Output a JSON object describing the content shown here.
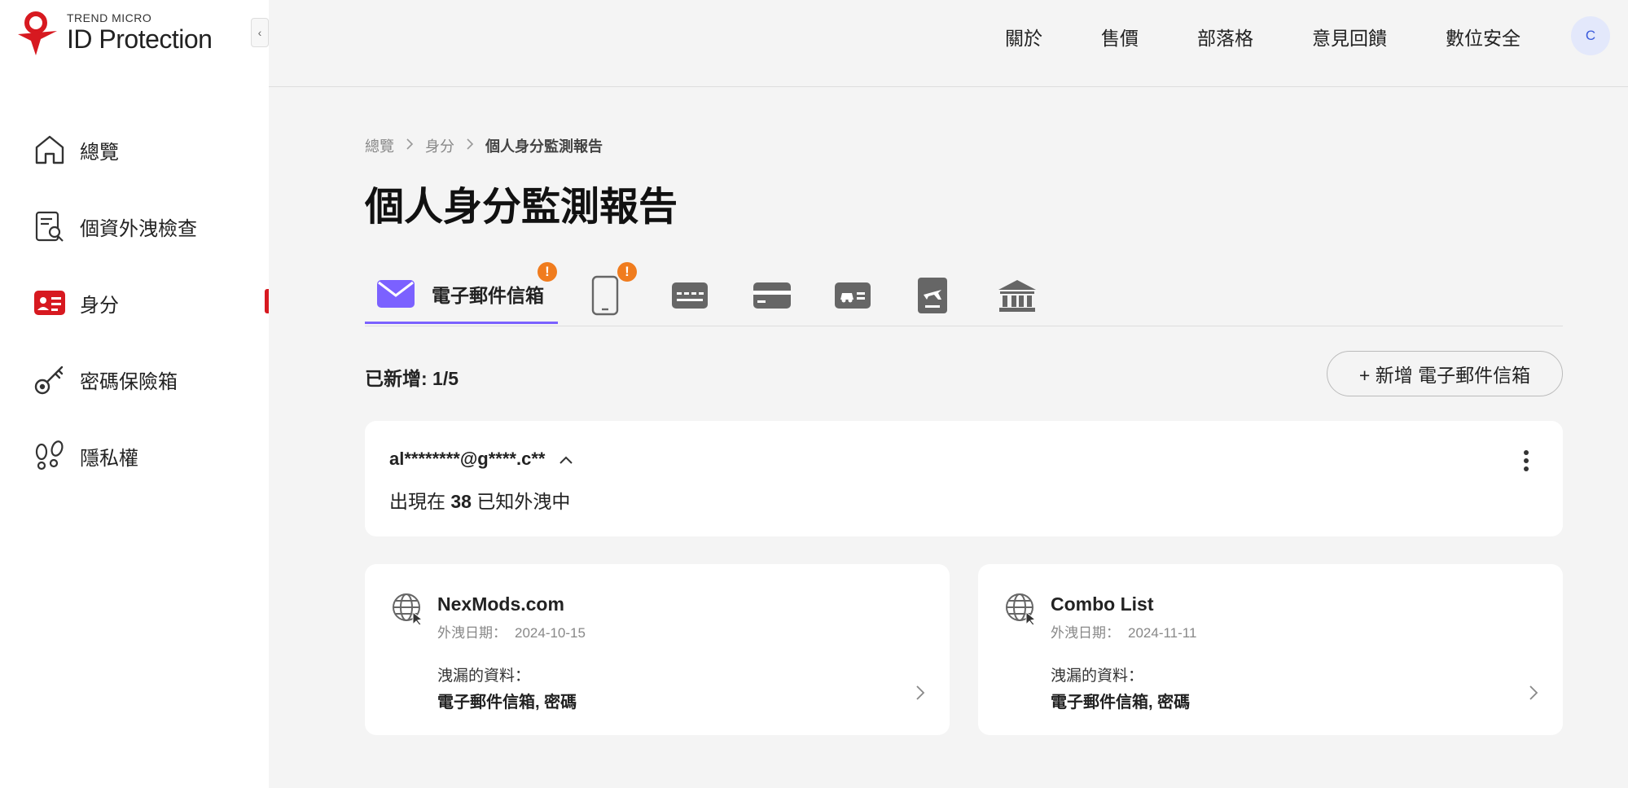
{
  "brand": {
    "top": "TREND MICRO",
    "main": "ID Protection",
    "color": "#d71920"
  },
  "sidebar": {
    "collapse_label": "‹",
    "items": [
      {
        "label": "總覽",
        "icon": "home-icon"
      },
      {
        "label": "個資外洩檢查",
        "icon": "document-search-icon"
      },
      {
        "label": "身分",
        "icon": "id-card-icon",
        "active": true
      },
      {
        "label": "密碼保險箱",
        "icon": "key-icon"
      },
      {
        "label": "隱私權",
        "icon": "footprints-icon"
      }
    ]
  },
  "topnav": {
    "links": [
      "關於",
      "售價",
      "部落格",
      "意見回饋",
      "數位安全"
    ],
    "avatar_initial": "C"
  },
  "breadcrumb": {
    "items": [
      "總覽",
      "身分",
      "個人身分監測報告"
    ],
    "separator": ">"
  },
  "page_title": "個人身分監測報告",
  "tabs": [
    {
      "label": "電子郵件信箱",
      "icon": "mail-icon",
      "active": true,
      "alert": "!"
    },
    {
      "label": "",
      "icon": "phone-icon",
      "alert": "!"
    },
    {
      "label": "",
      "icon": "id-card-horizontal-icon"
    },
    {
      "label": "",
      "icon": "credit-card-icon"
    },
    {
      "label": "",
      "icon": "driver-license-icon"
    },
    {
      "label": "",
      "icon": "passport-icon"
    },
    {
      "label": "",
      "icon": "bank-icon"
    }
  ],
  "accent_color": "#7b61ff",
  "alert_color": "#f07c1e",
  "added": {
    "text": "已新增: 1/5"
  },
  "add_button": {
    "label": "+ 新增 電子郵件信箱"
  },
  "email_card": {
    "address": "al********@g****.c**",
    "summary_prefix": "出現在",
    "count": "38",
    "summary_suffix": "已知外洩中"
  },
  "breaches": [
    {
      "name": "NexMods.com",
      "date_label": "外洩日期：",
      "date": "2024-10-15",
      "leaked_label": "洩漏的資料：",
      "leaked_value": "電子郵件信箱, 密碼"
    },
    {
      "name": "Combo List",
      "date_label": "外洩日期：",
      "date": "2024-11-11",
      "leaked_label": "洩漏的資料：",
      "leaked_value": "電子郵件信箱, 密碼"
    }
  ]
}
